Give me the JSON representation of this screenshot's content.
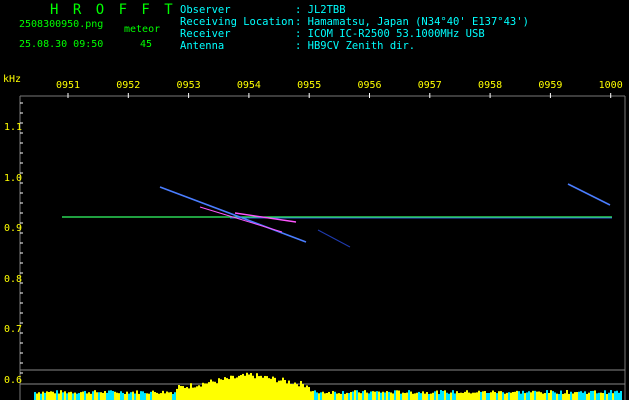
{
  "header": {
    "title": "H R O F F T",
    "filename": "2508300950.png",
    "timestamp": "25.08.30 09:50",
    "meteor_label": "meteor",
    "meteor_count": "45"
  },
  "info": [
    {
      "key": "Observer",
      "value": ": JL2TBB"
    },
    {
      "key": "Receiving Location",
      "value": ": Hamamatsu, Japan (N34°40' E137°43')"
    },
    {
      "key": "Receiver",
      "value": ": ICOM IC-R2500 53.1000MHz USB"
    },
    {
      "key": "Antenna",
      "value": ": HB9CV Zenith dir."
    }
  ],
  "axes": {
    "y_unit": "kHz",
    "x_ticks": [
      "0951",
      "0952",
      "0953",
      "0954",
      "0955",
      "0956",
      "0957",
      "0958",
      "0959",
      "1000"
    ],
    "y_ticks": [
      "1.1",
      "1.0",
      "0.9",
      "0.8",
      "0.7",
      "0.6"
    ]
  },
  "colors": {
    "header_green": "#00ff00",
    "info_cyan": "#00ffff",
    "axis_yellow": "#ffff00",
    "carrier_line": "#33ff66",
    "echo_blue": "#4a7dff",
    "spectrum_yellow": "#ffff00",
    "spectrum_cyan": "#00e5ff"
  }
}
